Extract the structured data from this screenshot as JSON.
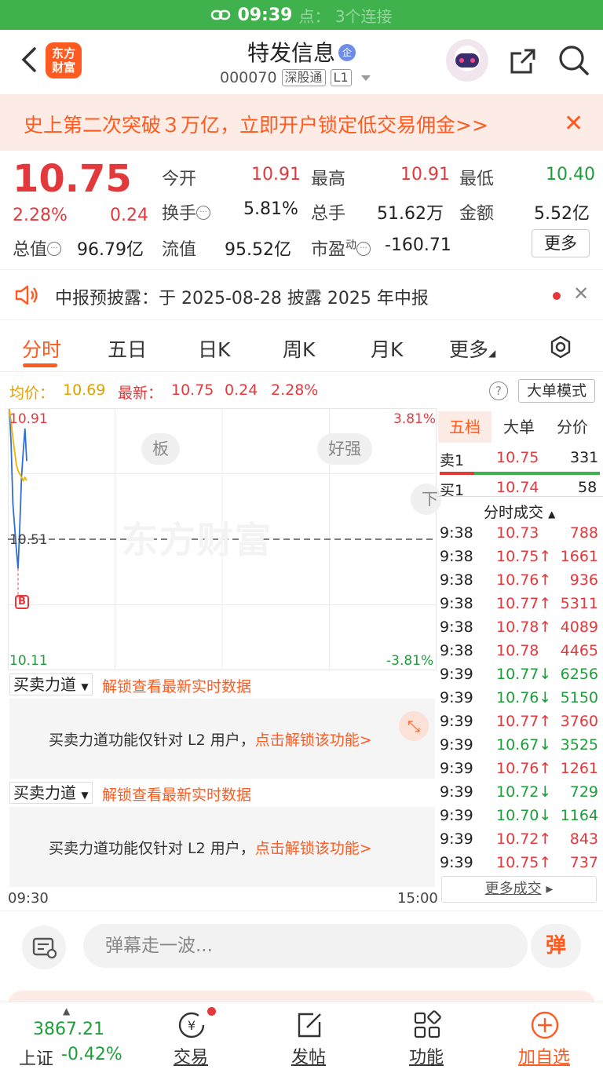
{
  "statusbar": {
    "time": "09:39",
    "hint": "点： 3个连接"
  },
  "header": {
    "logo_line1": "东方",
    "logo_line2": "财富",
    "name": "特发信息",
    "name_badge": "企",
    "code": "000070",
    "tag1": "深股通",
    "tag2": "L1"
  },
  "banner": {
    "text": "史上第二次突破３万亿，立即开户锁定低交易佣金>>"
  },
  "quote": {
    "price": "10.75",
    "change_pct": "2.28%",
    "change": "0.24",
    "open_label": "今开",
    "open": "10.91",
    "high_label": "最高",
    "high": "10.91",
    "low_label": "最低",
    "low": "10.40",
    "turnover_label": "换手",
    "turnover": "5.81%",
    "volume_label": "总手",
    "volume": "51.62万",
    "amount_label": "金额",
    "amount": "5.52亿",
    "mktcap_label": "总值",
    "mktcap": "96.79亿",
    "float_label": "流值",
    "float": "95.52亿",
    "pe_label": "市盈",
    "pe_sup": "动",
    "pe": "-160.71",
    "more": "更多"
  },
  "notice": {
    "text": "中报预披露：于 2025-08-28 披露 2025 年中报"
  },
  "tabs": [
    "分时",
    "五日",
    "日K",
    "周K",
    "月K",
    "更多",
    ""
  ],
  "priceline": {
    "avg_label": "均价：",
    "avg": "10.69",
    "latest_label": "最新：",
    "latest": "10.75",
    "chg": "0.24",
    "pct": "2.28%",
    "mode_button": "大单模式",
    "help": "?"
  },
  "chart": {
    "y_top": "10.91",
    "y_mid": "10.51",
    "y_bottom": "10.11",
    "pct_top": "3.81%",
    "pct_bottom": "-3.81%",
    "pill1": "板",
    "pill2": "好强",
    "pill3": "下",
    "watermark": "东方财富",
    "marker": "B",
    "time_start": "09:30",
    "time_end": "15:00"
  },
  "chart_data": {
    "type": "line",
    "ylim": [
      10.11,
      10.91
    ],
    "ref": 10.51,
    "series": [
      {
        "name": "",
        "values": [
          10.91,
          10.8,
          10.62,
          10.55,
          10.48,
          10.42,
          10.55,
          10.7,
          10.78,
          10.85,
          10.75
        ]
      },
      {
        "name": "",
        "values": [
          10.91,
          10.87,
          10.82,
          10.78,
          10.74,
          10.72,
          10.71,
          10.7,
          10.69,
          10.7,
          10.69
        ]
      }
    ]
  },
  "book": {
    "tabs": [
      "五档",
      "大单",
      "分价"
    ],
    "sell_label": "卖1",
    "sell_price": "10.75",
    "sell_vol": "331",
    "buy_label": "买1",
    "buy_price": "10.74",
    "buy_vol": "58",
    "trades_title": "分时成交",
    "trades": [
      {
        "t": "9:38",
        "p": "10.73",
        "v": "788",
        "c": "red"
      },
      {
        "t": "9:38",
        "p": "10.75↑",
        "v": "1661",
        "c": "red"
      },
      {
        "t": "9:38",
        "p": "10.76↑",
        "v": "936",
        "c": "red"
      },
      {
        "t": "9:38",
        "p": "10.77↑",
        "v": "5311",
        "c": "red"
      },
      {
        "t": "9:38",
        "p": "10.78↑",
        "v": "4089",
        "c": "red"
      },
      {
        "t": "9:38",
        "p": "10.78",
        "v": "4465",
        "c": "red"
      },
      {
        "t": "9:39",
        "p": "10.77↓",
        "v": "6256",
        "c": "green"
      },
      {
        "t": "9:39",
        "p": "10.76↓",
        "v": "5150",
        "c": "green"
      },
      {
        "t": "9:39",
        "p": "10.77↑",
        "v": "3760",
        "c": "red"
      },
      {
        "t": "9:39",
        "p": "10.67↓",
        "v": "3525",
        "c": "green"
      },
      {
        "t": "9:39",
        "p": "10.76↑",
        "v": "1261",
        "c": "red"
      },
      {
        "t": "9:39",
        "p": "10.72↓",
        "v": "729",
        "c": "green"
      },
      {
        "t": "9:39",
        "p": "10.70↓",
        "v": "1164",
        "c": "green"
      },
      {
        "t": "9:39",
        "p": "10.72↑",
        "v": "843",
        "c": "red"
      },
      {
        "t": "9:39",
        "p": "10.75↑",
        "v": "737",
        "c": "red"
      }
    ],
    "more_trades": "更多成交"
  },
  "panels": {
    "select_label": "买卖力道",
    "unlock_link": "解锁查看最新实时数据",
    "msg_prefix": "买卖力道功能仅针对 L2 用户，",
    "msg_link": "点击解锁该功能>"
  },
  "comment": {
    "placeholder": "弹幕走一波...",
    "send": "弹"
  },
  "bottomnav": {
    "index_value": "3867.21",
    "index_name": "上证",
    "index_pct": "-0.42%",
    "items": [
      "交易",
      "发帖",
      "功能",
      "加自选"
    ]
  }
}
